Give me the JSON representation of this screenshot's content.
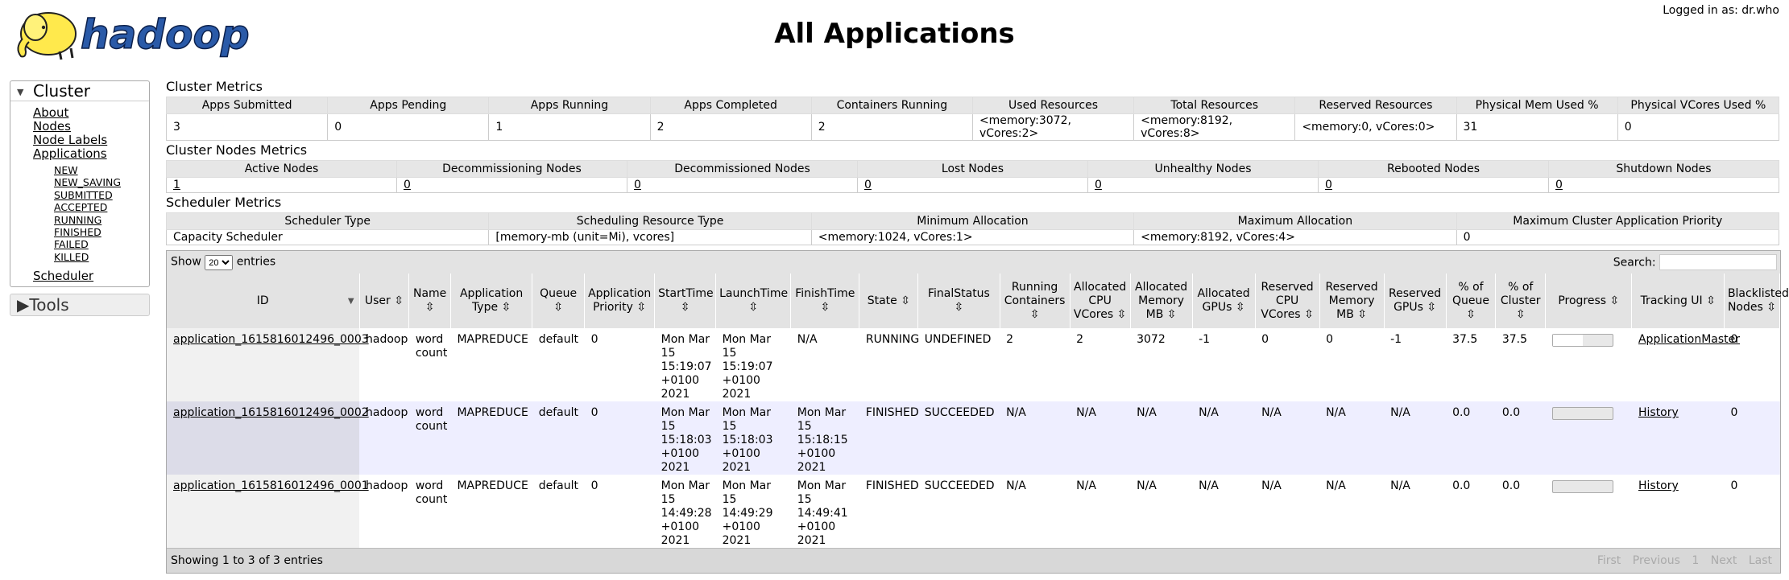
{
  "header": {
    "logo_text": "hadoop",
    "title": "All Applications",
    "user_info": "Logged in as: dr.who"
  },
  "nav": {
    "cluster_label": "Cluster",
    "links": [
      "About",
      "Nodes",
      "Node Labels",
      "Applications"
    ],
    "app_states": [
      "NEW",
      "NEW_SAVING",
      "SUBMITTED",
      "ACCEPTED",
      "RUNNING",
      "FINISHED",
      "FAILED",
      "KILLED"
    ],
    "scheduler_link": "Scheduler",
    "tools_label": "Tools"
  },
  "cluster_metrics": {
    "title": "Cluster Metrics",
    "headers": [
      "Apps Submitted",
      "Apps Pending",
      "Apps Running",
      "Apps Completed",
      "Containers Running",
      "Used Resources",
      "Total Resources",
      "Reserved Resources",
      "Physical Mem Used %",
      "Physical VCores Used %"
    ],
    "values": [
      "3",
      "0",
      "1",
      "2",
      "2",
      "<memory:3072, vCores:2>",
      "<memory:8192, vCores:8>",
      "<memory:0, vCores:0>",
      "31",
      "0"
    ]
  },
  "node_metrics": {
    "title": "Cluster Nodes Metrics",
    "headers": [
      "Active Nodes",
      "Decommissioning Nodes",
      "Decommissioned Nodes",
      "Lost Nodes",
      "Unhealthy Nodes",
      "Rebooted Nodes",
      "Shutdown Nodes"
    ],
    "values": [
      "1",
      "0",
      "0",
      "0",
      "0",
      "0",
      "0"
    ]
  },
  "scheduler_metrics": {
    "title": "Scheduler Metrics",
    "headers": [
      "Scheduler Type",
      "Scheduling Resource Type",
      "Minimum Allocation",
      "Maximum Allocation",
      "Maximum Cluster Application Priority"
    ],
    "values": [
      "Capacity Scheduler",
      "[memory-mb (unit=Mi), vcores]",
      "<memory:1024, vCores:1>",
      "<memory:8192, vCores:4>",
      "0"
    ]
  },
  "apps_table": {
    "show_label": "Show",
    "entries_value": "20",
    "entries_label": "entries",
    "search_label": "Search:",
    "search_value": "",
    "columns": [
      "ID",
      "User",
      "Name",
      "Application Type",
      "Queue",
      "Application Priority",
      "StartTime",
      "LaunchTime",
      "FinishTime",
      "State",
      "FinalStatus",
      "Running Containers",
      "Allocated CPU VCores",
      "Allocated Memory MB",
      "Allocated GPUs",
      "Reserved CPU VCores",
      "Reserved Memory MB",
      "Reserved GPUs",
      "% of Queue",
      "% of Cluster",
      "Progress",
      "Tracking UI",
      "Blacklisted Nodes"
    ],
    "rows": [
      {
        "id": "application_1615816012496_0003",
        "user": "hadoop",
        "name": "word count",
        "type": "MAPREDUCE",
        "queue": "default",
        "priority": "0",
        "start": "Mon Mar 15 15:19:07 +0100 2021",
        "launch": "Mon Mar 15 15:19:07 +0100 2021",
        "finish": "N/A",
        "state": "RUNNING",
        "final_status": "UNDEFINED",
        "running_containers": "2",
        "alloc_vcores": "2",
        "alloc_mem": "3072",
        "alloc_gpus": "-1",
        "res_vcores": "0",
        "res_mem": "0",
        "res_gpus": "-1",
        "pct_queue": "37.5",
        "pct_cluster": "37.5",
        "progress": 0.5,
        "tracking": "ApplicationMaster",
        "blacklisted": "0"
      },
      {
        "id": "application_1615816012496_0002",
        "user": "hadoop",
        "name": "word count",
        "type": "MAPREDUCE",
        "queue": "default",
        "priority": "0",
        "start": "Mon Mar 15 15:18:03 +0100 2021",
        "launch": "Mon Mar 15 15:18:03 +0100 2021",
        "finish": "Mon Mar 15 15:18:15 +0100 2021",
        "state": "FINISHED",
        "final_status": "SUCCEEDED",
        "running_containers": "N/A",
        "alloc_vcores": "N/A",
        "alloc_mem": "N/A",
        "alloc_gpus": "N/A",
        "res_vcores": "N/A",
        "res_mem": "N/A",
        "res_gpus": "N/A",
        "pct_queue": "0.0",
        "pct_cluster": "0.0",
        "progress": 1.0,
        "tracking": "History",
        "blacklisted": "0"
      },
      {
        "id": "application_1615816012496_0001",
        "user": "hadoop",
        "name": "word count",
        "type": "MAPREDUCE",
        "queue": "default",
        "priority": "0",
        "start": "Mon Mar 15 14:49:28 +0100 2021",
        "launch": "Mon Mar 15 14:49:29 +0100 2021",
        "finish": "Mon Mar 15 14:49:41 +0100 2021",
        "state": "FINISHED",
        "final_status": "SUCCEEDED",
        "running_containers": "N/A",
        "alloc_vcores": "N/A",
        "alloc_mem": "N/A",
        "alloc_gpus": "N/A",
        "res_vcores": "N/A",
        "res_mem": "N/A",
        "res_gpus": "N/A",
        "pct_queue": "0.0",
        "pct_cluster": "0.0",
        "progress": 1.0,
        "tracking": "History",
        "blacklisted": "0"
      }
    ],
    "footer_info": "Showing 1 to 3 of 3 entries",
    "pager": [
      "First",
      "Previous",
      "1",
      "Next",
      "Last"
    ]
  }
}
